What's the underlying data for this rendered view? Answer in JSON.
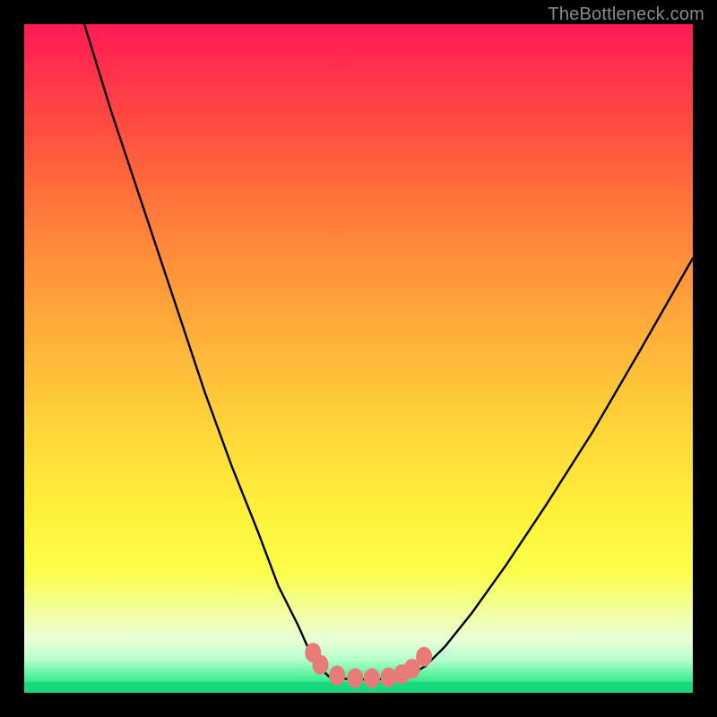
{
  "watermark": "TheBottleneck.com",
  "chart_data": {
    "type": "line",
    "title": "",
    "xlabel": "",
    "ylabel": "",
    "xlim": [
      0,
      100
    ],
    "ylim": [
      0,
      100
    ],
    "grid": false,
    "legend": false,
    "series": [
      {
        "name": "left-curve",
        "x": [
          9,
          13,
          18,
          23,
          27,
          31,
          35,
          38,
          41,
          43,
          44.5,
          45.5
        ],
        "values": [
          100,
          87,
          72,
          57,
          45,
          34,
          24,
          16,
          10,
          5.5,
          3.5,
          2.5
        ]
      },
      {
        "name": "flat-bottom",
        "x": [
          45.5,
          47,
          49,
          51,
          53,
          55,
          57,
          58
        ],
        "values": [
          2.5,
          2.2,
          2.0,
          2.0,
          2.0,
          2.2,
          2.5,
          2.8
        ]
      },
      {
        "name": "right-curve",
        "x": [
          58,
          60,
          63,
          67,
          72,
          78,
          85,
          92,
          100
        ],
        "values": [
          2.8,
          4,
          7,
          12,
          19,
          28,
          39,
          51,
          65
        ]
      }
    ],
    "markers": {
      "name": "highlight-dots",
      "x": [
        43.2,
        44.3,
        46.8,
        49.5,
        52.0,
        54.5,
        56.5,
        58.0,
        59.8
      ],
      "values": [
        6.0,
        4.2,
        2.6,
        2.2,
        2.2,
        2.3,
        2.8,
        3.6,
        5.4
      ]
    },
    "background_gradient": {
      "top": "#ff1a55",
      "mid": "#ffd93a",
      "bottom": "#19d97e"
    }
  }
}
